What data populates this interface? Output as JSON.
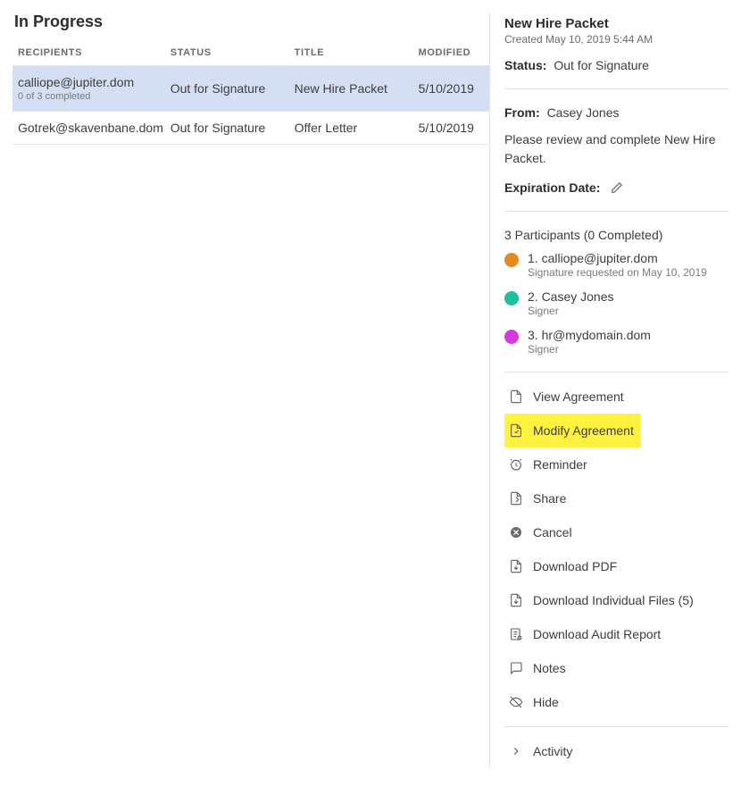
{
  "page_title": "In Progress",
  "columns": {
    "recipients": "RECIPIENTS",
    "status": "STATUS",
    "title": "TITLE",
    "modified": "MODIFIED"
  },
  "rows": [
    {
      "recipient": "calliope@jupiter.dom",
      "sub": "0 of 3 completed",
      "status": "Out for Signature",
      "title": "New Hire Packet",
      "modified": "5/10/2019",
      "selected": true
    },
    {
      "recipient": "Gotrek@skavenbane.dom",
      "sub": "",
      "status": "Out for Signature",
      "title": "Offer Letter",
      "modified": "5/10/2019",
      "selected": false
    }
  ],
  "detail": {
    "title": "New Hire Packet",
    "created": "Created May 10, 2019 5:44 AM",
    "status_label": "Status:",
    "status_value": "Out for Signature",
    "from_label": "From:",
    "from_value": "Casey Jones",
    "message": "Please review and complete New Hire Packet.",
    "expiration_label": "Expiration Date:",
    "participants_header": "3 Participants (0 Completed)",
    "participants": [
      {
        "color": "#e68a1f",
        "name": "1. calliope@jupiter.dom",
        "sub": "Signature requested on May 10, 2019"
      },
      {
        "color": "#1fbf9c",
        "name": "2. Casey Jones",
        "sub": "Signer"
      },
      {
        "color": "#d63adf",
        "name": "3. hr@mydomain.dom",
        "sub": "Signer"
      }
    ],
    "actions": {
      "view": "View Agreement",
      "modify": "Modify Agreement",
      "reminder": "Reminder",
      "share": "Share",
      "cancel": "Cancel",
      "download_pdf": "Download PDF",
      "download_files": "Download Individual Files (5)",
      "audit": "Download Audit Report",
      "notes": "Notes",
      "hide": "Hide",
      "activity": "Activity"
    }
  }
}
